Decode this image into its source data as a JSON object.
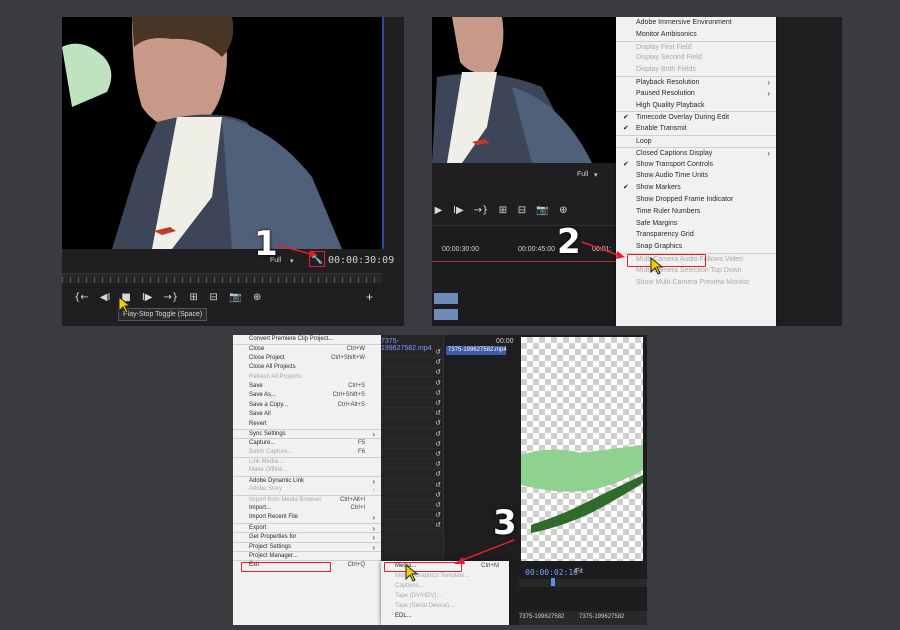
{
  "steps": {
    "step1": "1",
    "step2": "2",
    "step3": "3"
  },
  "panel1": {
    "resolution": "Full",
    "timecode": "00:00:30:09",
    "tooltip": "Play-Stop Toggle (Space)",
    "wrench_icon": "wrench-icon",
    "transport": [
      "{←",
      "◀I",
      "■",
      "I▶",
      "→}",
      "⊞",
      "⊟",
      "📷",
      "⊕"
    ],
    "plus": "+"
  },
  "panel2": {
    "resolution": "Full",
    "ruler": [
      "00:00:30:00",
      "00:00:45:00",
      "00:01:"
    ],
    "transport": [
      "▶",
      "I▶",
      "→}",
      "⊞",
      "⊟",
      "📷",
      "⊕"
    ],
    "menu": [
      {
        "label": "Adobe Immersive Environment",
        "check": false,
        "arrow": false,
        "disabled": false,
        "sep": false
      },
      {
        "label": "Monitor Ambisonics",
        "check": false,
        "arrow": false,
        "disabled": false,
        "sep": false
      },
      {
        "label": "Display First Field",
        "check": false,
        "arrow": false,
        "disabled": true,
        "sep": true
      },
      {
        "label": "Display Second Field",
        "check": false,
        "arrow": false,
        "disabled": true,
        "sep": false
      },
      {
        "label": "Display Both Fields",
        "check": false,
        "arrow": false,
        "disabled": true,
        "sep": false
      },
      {
        "label": "Playback Resolution",
        "check": false,
        "arrow": true,
        "disabled": false,
        "sep": true
      },
      {
        "label": "Paused Resolution",
        "check": false,
        "arrow": true,
        "disabled": false,
        "sep": false
      },
      {
        "label": "High Quality Playback",
        "check": false,
        "arrow": false,
        "disabled": false,
        "sep": false
      },
      {
        "label": "Timecode Overlay During Edit",
        "check": true,
        "arrow": false,
        "disabled": false,
        "sep": true
      },
      {
        "label": "Enable Transmit",
        "check": true,
        "arrow": false,
        "disabled": false,
        "sep": false
      },
      {
        "label": "Loop",
        "check": false,
        "arrow": false,
        "disabled": false,
        "sep": true
      },
      {
        "label": "Closed Captions Display",
        "check": false,
        "arrow": true,
        "disabled": false,
        "sep": true
      },
      {
        "label": "Show Transport Controls",
        "check": true,
        "arrow": false,
        "disabled": false,
        "sep": false
      },
      {
        "label": "Show Audio Time Units",
        "check": false,
        "arrow": false,
        "disabled": false,
        "sep": false
      },
      {
        "label": "Show Markers",
        "check": true,
        "arrow": false,
        "disabled": false,
        "sep": false
      },
      {
        "label": "Show Dropped Frame Indicator",
        "check": false,
        "arrow": false,
        "disabled": false,
        "sep": false
      },
      {
        "label": "Time Ruler Numbers",
        "check": false,
        "arrow": false,
        "disabled": false,
        "sep": false
      },
      {
        "label": "Safe Margins",
        "check": false,
        "arrow": false,
        "disabled": false,
        "sep": false
      },
      {
        "label": "Transparency Grid",
        "check": false,
        "arrow": false,
        "disabled": false,
        "sep": false
      },
      {
        "label": "Snap Graphics",
        "check": false,
        "arrow": false,
        "disabled": false,
        "sep": false
      },
      {
        "label": "Multi-Camera Audio Follows Video",
        "check": false,
        "arrow": false,
        "disabled": true,
        "sep": true
      },
      {
        "label": "Multi-Camera Selection Top Down",
        "check": false,
        "arrow": false,
        "disabled": true,
        "sep": false
      },
      {
        "label": "Show Multi-Camera Preview Monitor",
        "check": false,
        "arrow": false,
        "disabled": true,
        "sep": false
      }
    ]
  },
  "panel3": {
    "file_menu": [
      {
        "label": "Convert Premiere Clip Project...",
        "shortcut": "",
        "arrow": false,
        "disabled": false,
        "sep": false
      },
      {
        "label": "Close",
        "shortcut": "Ctrl+W",
        "arrow": false,
        "disabled": false,
        "sep": true
      },
      {
        "label": "Close Project",
        "shortcut": "Ctrl+Shift+W",
        "arrow": false,
        "disabled": false,
        "sep": false
      },
      {
        "label": "Close All Projects",
        "shortcut": "",
        "arrow": false,
        "disabled": false,
        "sep": false
      },
      {
        "label": "Refresh All Projects",
        "shortcut": "",
        "arrow": false,
        "disabled": true,
        "sep": false
      },
      {
        "label": "Save",
        "shortcut": "Ctrl+S",
        "arrow": false,
        "disabled": false,
        "sep": false
      },
      {
        "label": "Save As...",
        "shortcut": "Ctrl+Shift+S",
        "arrow": false,
        "disabled": false,
        "sep": false
      },
      {
        "label": "Save a Copy...",
        "shortcut": "Ctrl+Alt+S",
        "arrow": false,
        "disabled": false,
        "sep": false
      },
      {
        "label": "Save All",
        "shortcut": "",
        "arrow": false,
        "disabled": false,
        "sep": false
      },
      {
        "label": "Revert",
        "shortcut": "",
        "arrow": false,
        "disabled": false,
        "sep": false
      },
      {
        "label": "Sync Settings",
        "shortcut": "",
        "arrow": true,
        "disabled": false,
        "sep": true
      },
      {
        "label": "Capture...",
        "shortcut": "F5",
        "arrow": false,
        "disabled": false,
        "sep": true
      },
      {
        "label": "Batch Capture...",
        "shortcut": "F6",
        "arrow": false,
        "disabled": true,
        "sep": false
      },
      {
        "label": "Link Media...",
        "shortcut": "",
        "arrow": false,
        "disabled": true,
        "sep": true
      },
      {
        "label": "Make Offline...",
        "shortcut": "",
        "arrow": false,
        "disabled": true,
        "sep": false
      },
      {
        "label": "Adobe Dynamic Link",
        "shortcut": "",
        "arrow": true,
        "disabled": false,
        "sep": true
      },
      {
        "label": "Adobe Story",
        "shortcut": "",
        "arrow": true,
        "disabled": true,
        "sep": false
      },
      {
        "label": "Import from Media Browser",
        "shortcut": "Ctrl+Alt+I",
        "arrow": false,
        "disabled": true,
        "sep": true
      },
      {
        "label": "Import...",
        "shortcut": "Ctrl+I",
        "arrow": false,
        "disabled": false,
        "sep": false
      },
      {
        "label": "Import Recent File",
        "shortcut": "",
        "arrow": true,
        "disabled": false,
        "sep": false
      },
      {
        "label": "Export",
        "shortcut": "",
        "arrow": true,
        "disabled": false,
        "sep": true
      },
      {
        "label": "Get Properties for",
        "shortcut": "",
        "arrow": true,
        "disabled": false,
        "sep": true
      },
      {
        "label": "Project Settings",
        "shortcut": "",
        "arrow": true,
        "disabled": false,
        "sep": true
      },
      {
        "label": "Project Manager...",
        "shortcut": "",
        "arrow": false,
        "disabled": false,
        "sep": true
      },
      {
        "label": "Exit",
        "shortcut": "Ctrl+Q",
        "arrow": false,
        "disabled": false,
        "sep": true
      }
    ],
    "export_menu": [
      {
        "label": "Media...",
        "shortcut": "Ctrl+M",
        "disabled": false
      },
      {
        "label": "Motion Graphics Template...",
        "shortcut": "",
        "disabled": true
      },
      {
        "label": "Captions...",
        "shortcut": "",
        "disabled": true
      },
      {
        "label": "Tape (DV/HDV)...",
        "shortcut": "",
        "disabled": true
      },
      {
        "label": "Tape (Serial Device)...",
        "shortcut": "",
        "disabled": true
      },
      {
        "label": "EDL...",
        "shortcut": "",
        "disabled": false
      }
    ],
    "project_clip": "7375-199627582.mp4",
    "project_clip2": "7375-199627582.mp4",
    "seq_tc": "00:00",
    "preview_tc": "00:00:02:16",
    "fit": "Fit",
    "bottom_tabs": [
      "7375-199627582",
      "7375-199627582"
    ]
  }
}
